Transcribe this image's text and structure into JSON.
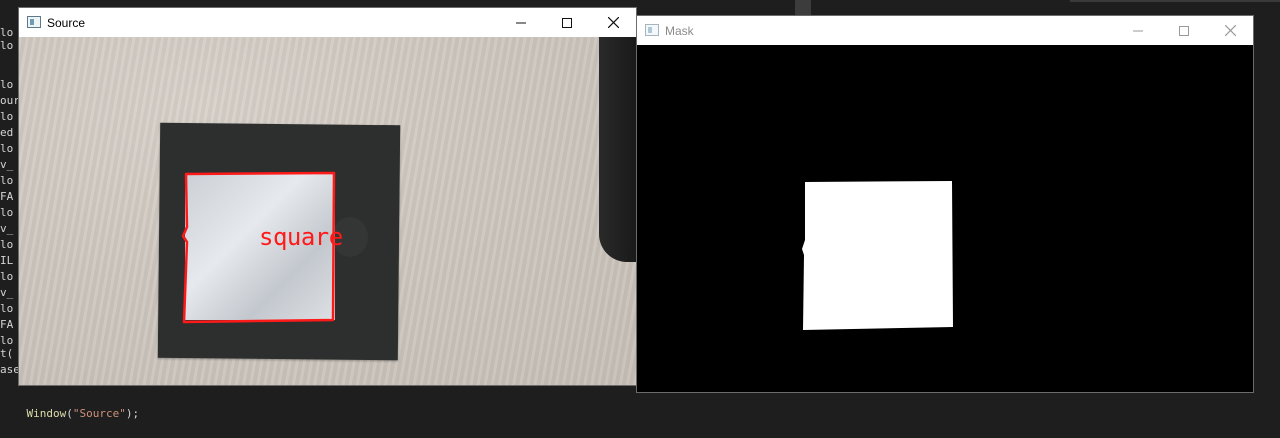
{
  "editor": {
    "left_fragments": [
      "lo",
      "lo",
      "",
      "lo",
      "our",
      "lo",
      "ed",
      "lo",
      "v_",
      "lo",
      "FA",
      "lo",
      "v_",
      "lo",
      "IL",
      "lo",
      "v_",
      "lo",
      "FA",
      "lo",
      "",
      "",
      "t(",
      "ase"
    ],
    "bottom_line": {
      "fn": "Window",
      "open": "(",
      "str": "\"Source\"",
      "close": ");"
    }
  },
  "source_window": {
    "title": "Source",
    "detected_shape_label": "square"
  },
  "mask_window": {
    "title": "Mask"
  },
  "controls": {
    "minimize": "—",
    "maximize": "☐",
    "close": "✕"
  },
  "colors": {
    "contour": "#ff1a1a",
    "editor_bg": "#1e1e1e",
    "mask_bg": "#000000",
    "mask_fg": "#ffffff"
  }
}
